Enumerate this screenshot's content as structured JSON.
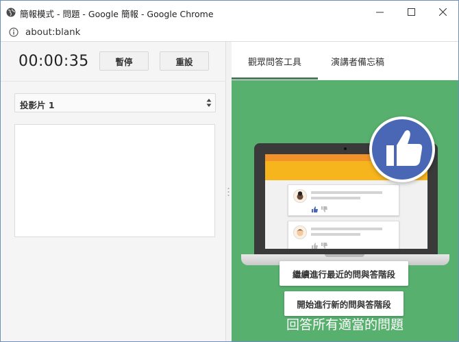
{
  "window": {
    "title": "簡報模式 - 問題 - Google 簡報 - Google Chrome"
  },
  "address": {
    "url": "about:blank"
  },
  "presenter": {
    "timer": "00:00:35",
    "pause_label": "暫停",
    "reset_label": "重設",
    "slide_select": "投影片 1"
  },
  "tabs": [
    {
      "label": "觀眾問答工具",
      "active": true
    },
    {
      "label": "演講者備忘稿",
      "active": false
    }
  ],
  "qa": {
    "continue_label": "繼續進行最近的問與答階段",
    "start_label": "開始進行新的問與答階段",
    "footer": "回答所有適當的問題"
  },
  "colors": {
    "accent_green": "#58b06f",
    "like_blue": "#4a67b5",
    "tab_underline": "#4a7a5a"
  },
  "icons": [
    "globe-icon",
    "minimize-icon",
    "maximize-icon",
    "close-icon",
    "info-icon",
    "select-arrows-icon",
    "thumbs-up-icon"
  ]
}
